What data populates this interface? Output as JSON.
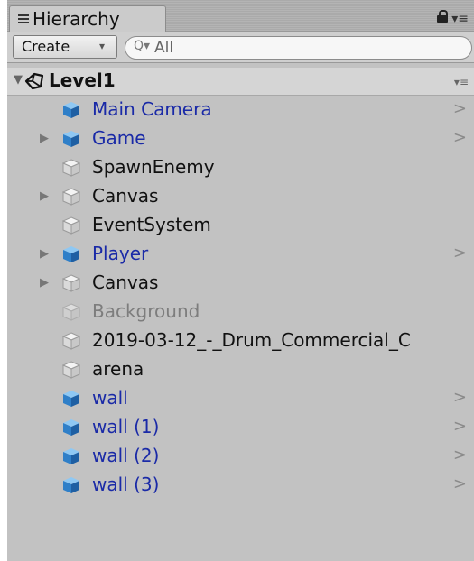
{
  "tab": {
    "label": "Hierarchy"
  },
  "toolbar": {
    "create_label": "Create",
    "search_placeholder": "All"
  },
  "scene": {
    "name": "Level1"
  },
  "rows": [
    {
      "label": "Main Camera",
      "type": "prefab",
      "foldout": false,
      "chevron": true
    },
    {
      "label": "Game",
      "type": "prefab",
      "foldout": true,
      "chevron": true
    },
    {
      "label": "SpawnEnemy",
      "type": "normal",
      "foldout": false,
      "chevron": false
    },
    {
      "label": "Canvas",
      "type": "normal",
      "foldout": true,
      "chevron": false
    },
    {
      "label": "EventSystem",
      "type": "normal",
      "foldout": false,
      "chevron": false
    },
    {
      "label": "Player",
      "type": "prefab",
      "foldout": true,
      "chevron": true
    },
    {
      "label": "Canvas",
      "type": "normal",
      "foldout": true,
      "chevron": false
    },
    {
      "label": "Background",
      "type": "inactive",
      "foldout": false,
      "chevron": false
    },
    {
      "label": "2019-03-12_-_Drum_Commercial_C",
      "type": "normal",
      "foldout": false,
      "chevron": false
    },
    {
      "label": "arena",
      "type": "normal",
      "foldout": false,
      "chevron": false
    },
    {
      "label": "wall",
      "type": "prefab",
      "foldout": false,
      "chevron": true
    },
    {
      "label": "wall (1)",
      "type": "prefab",
      "foldout": false,
      "chevron": true
    },
    {
      "label": "wall (2)",
      "type": "prefab",
      "foldout": false,
      "chevron": true
    },
    {
      "label": "wall (3)",
      "type": "prefab",
      "foldout": false,
      "chevron": true
    }
  ],
  "colors": {
    "prefab_text": "#1a2aa7",
    "normal_text": "#111111",
    "inactive_text": "#7d7d7d",
    "panel_bg": "#c2c2c2",
    "prefab_cube": "#3d8fd4",
    "normal_cube": "#e6e6e6"
  },
  "icons": {
    "tab": "hierarchy-list-icon",
    "lock": "lock-icon",
    "tab_menu": "tab-menu-icon",
    "search": "search-icon",
    "scene": "unity-logo-icon",
    "prefab": "prefab-cube-icon",
    "gameobject": "gameobject-cube-icon",
    "foldout": "foldout-arrow-icon",
    "chevron": "chevron-right-icon"
  }
}
